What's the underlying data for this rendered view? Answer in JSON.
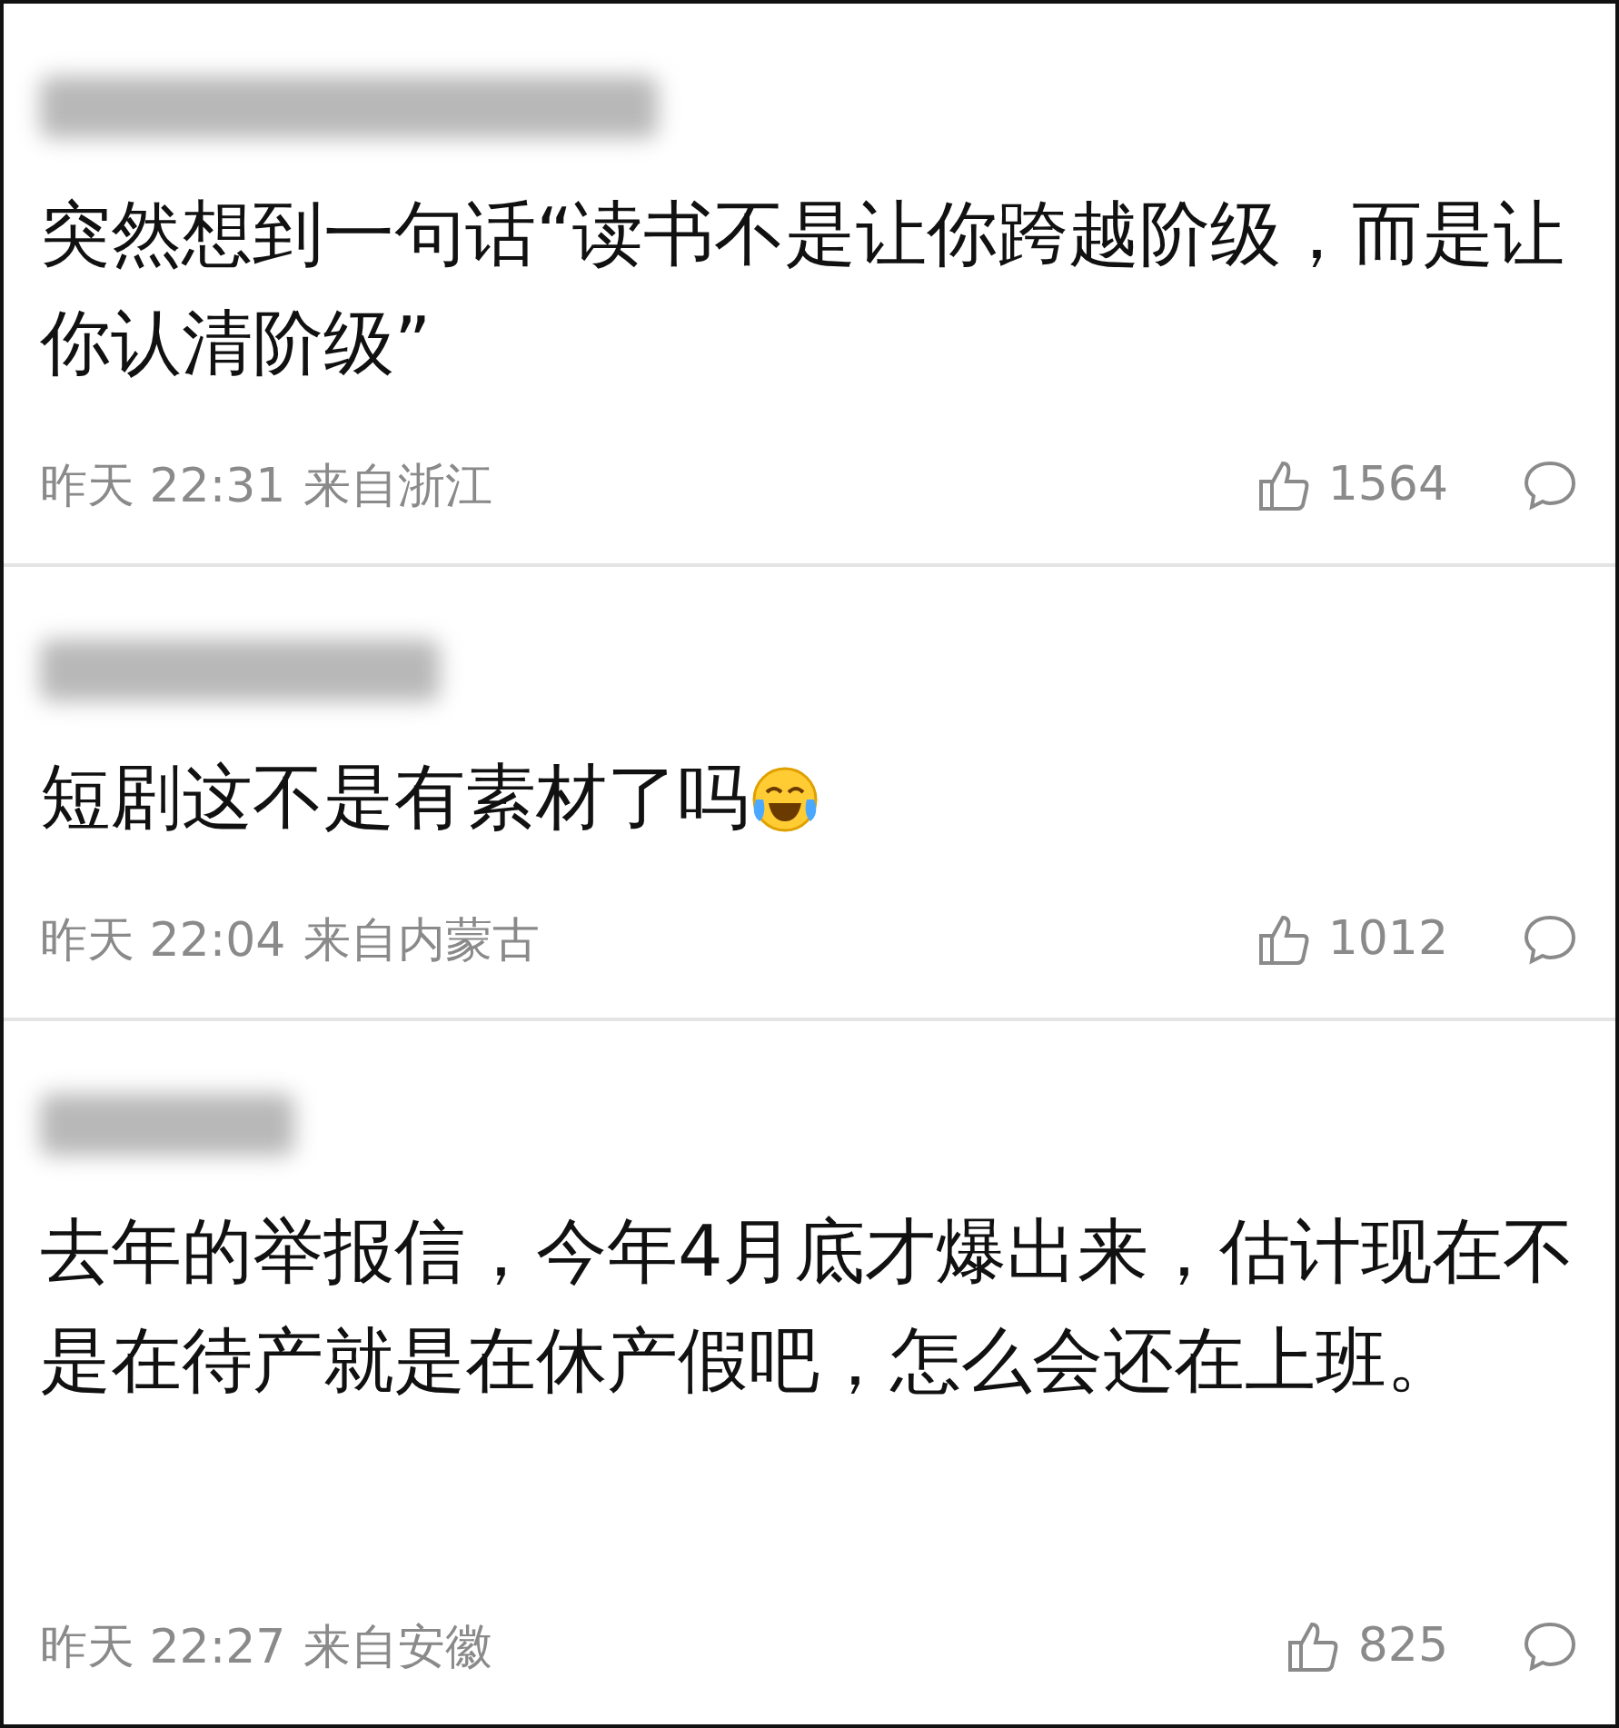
{
  "comments": [
    {
      "text": "突然想到一句话“读书不是让你跨越阶级，而是让你认清阶级”",
      "has_emoji": false,
      "time": "昨天 22:31",
      "location": "来自浙江",
      "likes": "1564"
    },
    {
      "text": "短剧这不是有素材了吗",
      "has_emoji": true,
      "time": "昨天 22:04",
      "location": "来自内蒙古",
      "likes": "1012"
    },
    {
      "text": "去年的举报信，今年4月底才爆出来，估计现在不是在待产就是在休产假吧，怎么会还在上班。",
      "has_emoji": false,
      "time": "昨天 22:27",
      "location": "来自安徽",
      "likes": "825"
    }
  ]
}
